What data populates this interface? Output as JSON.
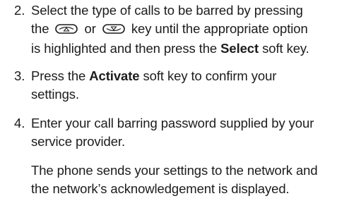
{
  "steps": [
    {
      "number": "2.",
      "line1": "Select the type of calls to be barred by pressing",
      "line2_before": "the",
      "line2_between": "or",
      "line2_after": "key until the appropriate option",
      "line3_before": "is highlighted and then press the",
      "line3_bold": "Select",
      "line3_after": "soft key."
    },
    {
      "number": "3.",
      "line1_before": "Press the",
      "line1_bold": "Activate",
      "line1_after": "soft key to confirm your",
      "line2": "settings."
    },
    {
      "number": "4.",
      "line1": "Enter your call barring password supplied by your",
      "line2": "service provider."
    }
  ],
  "note": {
    "line1": "The phone sends your settings to the network and",
    "line2": "the network’s acknowledgement is displayed."
  },
  "icons": {
    "up_key": "up-arrow-key-icon",
    "down_key": "down-arrow-key-icon"
  }
}
